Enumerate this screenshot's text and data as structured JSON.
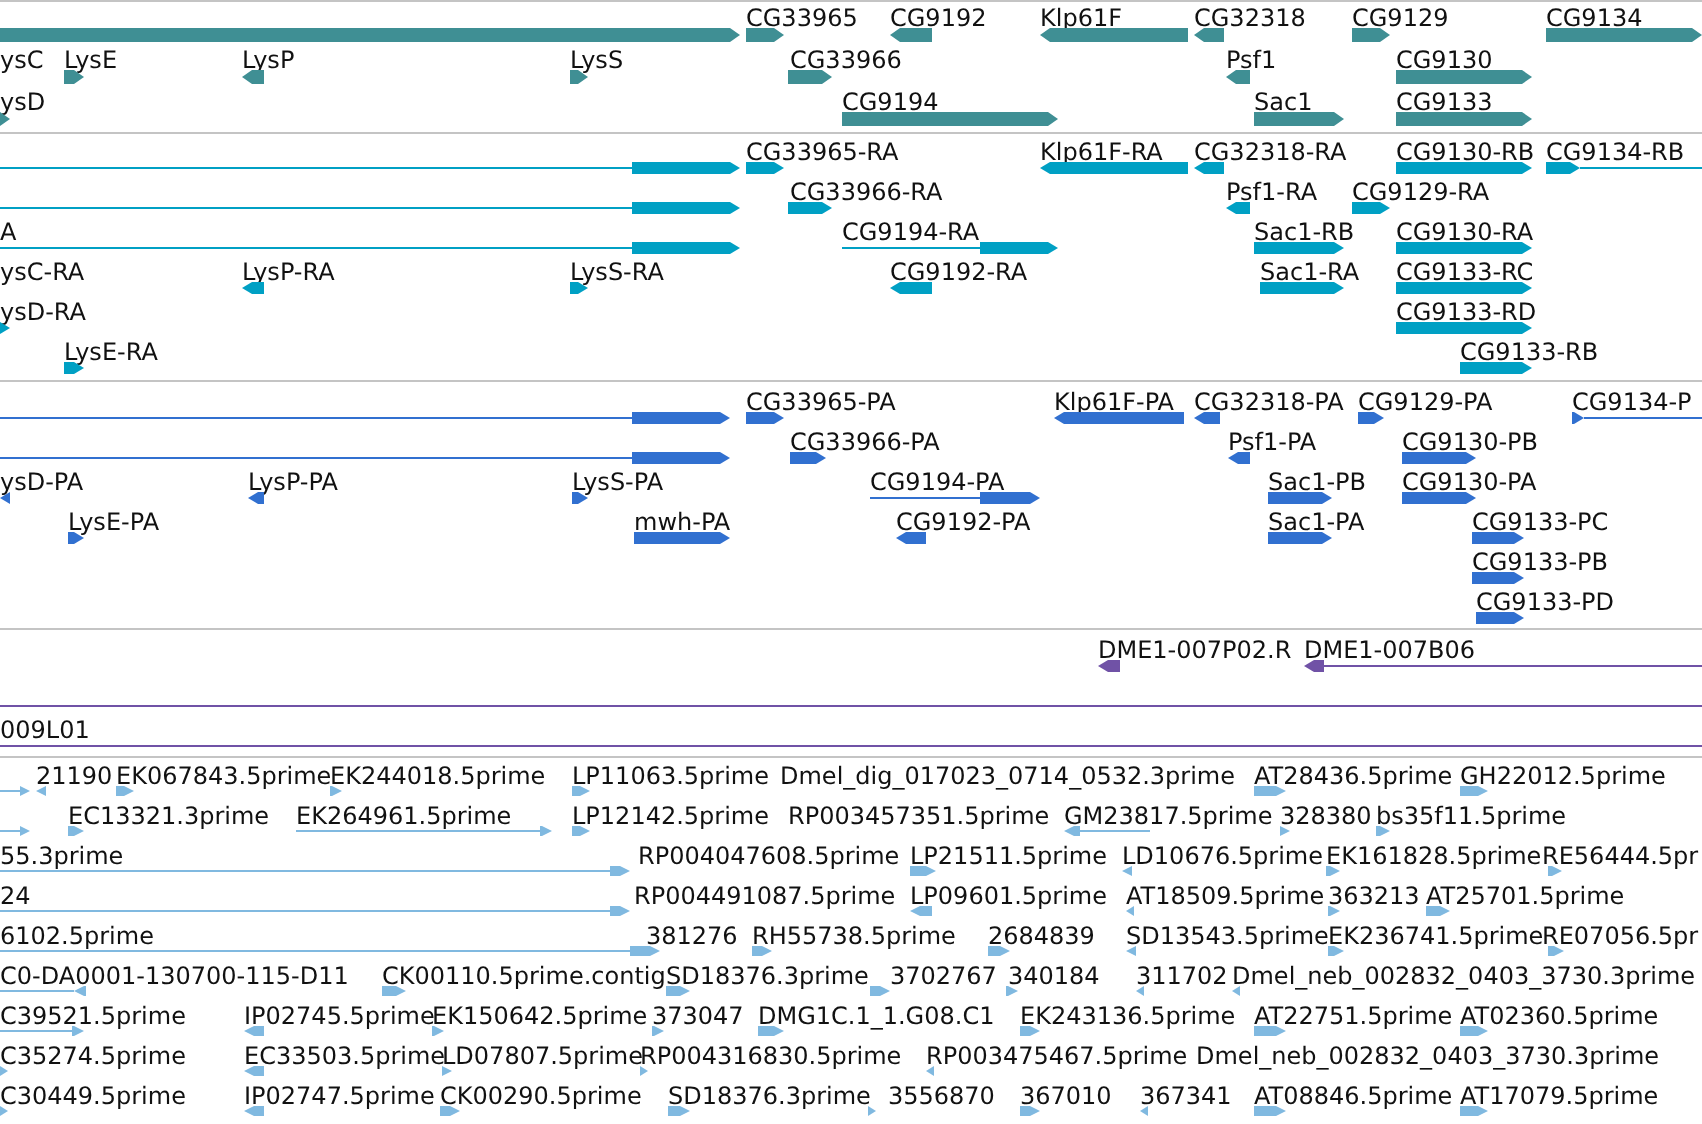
{
  "tracks": [
    {
      "kind": "gene",
      "rows": [
        {
          "features": [
            {
              "kind": "arrow",
              "reverse": false
            },
            {
              "label": "CG33965",
              "kind": "arrow",
              "reverse": false
            },
            {
              "label": "CG9192",
              "kind": "arrow",
              "reverse": true
            },
            {
              "label": "Klp61F",
              "kind": "arrow",
              "reverse": true
            },
            {
              "label": "CG32318",
              "kind": "arrow",
              "reverse": true
            },
            {
              "label": "CG9129",
              "kind": "arrow",
              "reverse": false
            },
            {
              "label": "CG9134",
              "kind": "arrow",
              "reverse": false
            }
          ]
        },
        {
          "features": [
            {
              "label": "ysC",
              "kind": "label"
            },
            {
              "label": "LysE",
              "kind": "arrow",
              "reverse": false
            },
            {
              "label": "LysP",
              "kind": "arrow",
              "reverse": true
            },
            {
              "label": "LysS",
              "kind": "arrow",
              "reverse": false
            },
            {
              "label": "CG33966",
              "kind": "arrow",
              "reverse": false
            },
            {
              "label": "Psf1",
              "kind": "arrow",
              "reverse": true
            },
            {
              "label": "CG9130",
              "kind": "arrow",
              "reverse": false
            }
          ]
        },
        {
          "features": [
            {
              "label": "ysD",
              "kind": "arrow",
              "reverse": false
            },
            {
              "label": "CG9194",
              "kind": "arrow",
              "reverse": false
            },
            {
              "label": "Sac1",
              "kind": "arrow",
              "reverse": false
            },
            {
              "label": "CG9133",
              "kind": "arrow",
              "reverse": false
            }
          ]
        }
      ]
    },
    {
      "kind": "mrna",
      "rows": [
        {
          "features": [
            {
              "kind": "arrow",
              "reverse": false
            },
            {
              "label": "CG33965-RA",
              "kind": "arrow",
              "reverse": false
            },
            {
              "label": "Klp61F-RA",
              "kind": "arrow",
              "reverse": true
            },
            {
              "label": "CG32318-RA",
              "kind": "arrow",
              "reverse": true
            },
            {
              "label": "CG9130-RB",
              "kind": "arrow",
              "reverse": false
            },
            {
              "label": "CG9134-RB",
              "kind": "arrow",
              "reverse": false
            }
          ]
        },
        {
          "features": [
            {
              "kind": "arrow",
              "reverse": false
            },
            {
              "label": "CG33966-RA",
              "kind": "arrow",
              "reverse": false
            },
            {
              "label": "Psf1-RA",
              "kind": "arrow",
              "reverse": true
            },
            {
              "label": "CG9129-RA",
              "kind": "arrow",
              "reverse": false
            }
          ]
        },
        {
          "features": [
            {
              "label": "A",
              "kind": "arrow",
              "reverse": false
            },
            {
              "label": "CG9194-RA",
              "kind": "arrow",
              "reverse": false
            },
            {
              "label": "Sac1-RB",
              "kind": "arrow",
              "reverse": false
            },
            {
              "label": "CG9130-RA",
              "kind": "arrow",
              "reverse": false
            }
          ]
        },
        {
          "features": [
            {
              "label": "ysC-RA",
              "kind": "label"
            },
            {
              "label": "LysP-RA",
              "kind": "arrow",
              "reverse": true
            },
            {
              "label": "LysS-RA",
              "kind": "arrow",
              "reverse": false
            },
            {
              "label": "CG9192-RA",
              "kind": "arrow",
              "reverse": true
            },
            {
              "label": "Sac1-RA",
              "kind": "arrow",
              "reverse": false
            },
            {
              "label": "CG9133-RC",
              "kind": "arrow",
              "reverse": false
            }
          ]
        },
        {
          "features": [
            {
              "label": "ysD-RA",
              "kind": "arrow",
              "reverse": false
            },
            {
              "label": "CG9133-RD",
              "kind": "arrow",
              "reverse": false
            }
          ]
        },
        {
          "features": [
            {
              "label": "LysE-RA",
              "kind": "arrow",
              "reverse": false
            },
            {
              "label": "CG9133-RB",
              "kind": "arrow",
              "reverse": false
            }
          ]
        }
      ]
    },
    {
      "kind": "protein",
      "rows": [
        {
          "features": [
            {
              "kind": "arrow",
              "reverse": false
            },
            {
              "label": "CG33965-PA",
              "kind": "arrow",
              "reverse": false
            },
            {
              "label": "Klp61F-PA",
              "kind": "arrow",
              "reverse": true
            },
            {
              "label": "CG32318-PA",
              "kind": "arrow",
              "reverse": true
            },
            {
              "label": "CG9129-PA",
              "kind": "arrow",
              "reverse": false
            },
            {
              "label": "CG9134-P",
              "kind": "arrow",
              "reverse": false
            }
          ]
        },
        {
          "features": [
            {
              "kind": "arrow",
              "reverse": false
            },
            {
              "label": "CG33966-PA",
              "kind": "arrow",
              "reverse": false
            },
            {
              "label": "Psf1-PA",
              "kind": "arrow",
              "reverse": true
            },
            {
              "label": "CG9130-PB",
              "kind": "arrow",
              "reverse": false
            }
          ]
        },
        {
          "features": [
            {
              "label": "ysD-PA",
              "kind": "arrow",
              "reverse": true
            },
            {
              "label": "LysP-PA",
              "kind": "arrow",
              "reverse": true
            },
            {
              "label": "LysS-PA",
              "kind": "arrow",
              "reverse": false
            },
            {
              "label": "CG9194-PA",
              "kind": "arrow",
              "reverse": false
            },
            {
              "label": "Sac1-PB",
              "kind": "arrow",
              "reverse": false
            },
            {
              "label": "CG9130-PA",
              "kind": "arrow",
              "reverse": false
            }
          ]
        },
        {
          "features": [
            {
              "label": "LysE-PA",
              "kind": "arrow",
              "reverse": false
            },
            {
              "label": "mwh-PA",
              "kind": "arrow",
              "reverse": false
            },
            {
              "label": "CG9192-PA",
              "kind": "arrow",
              "reverse": true
            },
            {
              "label": "Sac1-PA",
              "kind": "arrow",
              "reverse": false
            },
            {
              "label": "CG9133-PC",
              "kind": "arrow",
              "reverse": false
            }
          ]
        },
        {
          "features": [
            {
              "label": "CG9133-PB",
              "kind": "arrow",
              "reverse": false
            }
          ]
        },
        {
          "features": [
            {
              "label": "CG9133-PD",
              "kind": "arrow",
              "reverse": false
            }
          ]
        }
      ]
    },
    {
      "kind": "clone",
      "rows": [
        {
          "features": [
            {
              "label": "DME1-007P02.R",
              "kind": "arrow",
              "reverse": true
            },
            {
              "label": "DME1-007B06",
              "kind": "arrow",
              "reverse": true
            }
          ]
        },
        {
          "features": [
            {
              "kind": "line"
            }
          ]
        },
        {
          "features": [
            {
              "label": "009L01",
              "kind": "line"
            }
          ]
        }
      ]
    },
    {
      "kind": "est",
      "rows": [
        {
          "features": [
            {
              "kind": "arrow",
              "reverse": false
            },
            {
              "label": "21190",
              "kind": "arrow",
              "reverse": true
            },
            {
              "label": "EK067843.5prime",
              "kind": "arrow",
              "reverse": false
            },
            {
              "label": "EK244018.5prime",
              "kind": "arrow",
              "reverse": false
            },
            {
              "label": "LP11063.5prime",
              "kind": "arrow",
              "reverse": false
            },
            {
              "label": "Dmel_dig_017023_0714_0532.3prime",
              "kind": "label"
            },
            {
              "label": "AT28436.5prime",
              "kind": "arrow",
              "reverse": false
            },
            {
              "label": "GH22012.5prime",
              "kind": "arrow",
              "reverse": false
            }
          ]
        },
        {
          "features": [
            {
              "kind": "arrow",
              "reverse": false
            },
            {
              "label": "EC13321.3prime",
              "kind": "arrow",
              "reverse": false
            },
            {
              "label": "EK264961.5prime",
              "kind": "arrow",
              "reverse": false
            },
            {
              "label": "LP12142.5prime",
              "kind": "arrow",
              "reverse": false
            },
            {
              "label": "RP003457351.5prime",
              "kind": "label"
            },
            {
              "label": "GM23817.5prime",
              "kind": "arrow",
              "reverse": true
            },
            {
              "label": "328380",
              "kind": "arrow",
              "reverse": false
            },
            {
              "label": "bs35f11.5prime",
              "kind": "arrow",
              "reverse": false
            }
          ]
        },
        {
          "features": [
            {
              "label": "55.3prime",
              "kind": "arrow",
              "reverse": false
            },
            {
              "label": "RP004047608.5prime",
              "kind": "label"
            },
            {
              "label": "LP21511.5prime",
              "kind": "arrow",
              "reverse": false
            },
            {
              "label": "LD10676.5prime",
              "kind": "arrow",
              "reverse": true
            },
            {
              "label": "EK161828.5prime",
              "kind": "arrow",
              "reverse": false
            },
            {
              "label": "RE56444.5pr",
              "kind": "arrow",
              "reverse": false
            }
          ]
        },
        {
          "features": [
            {
              "label": "24",
              "kind": "arrow",
              "reverse": false
            },
            {
              "label": "RP004491087.5prime",
              "kind": "label"
            },
            {
              "label": "LP09601.5prime",
              "kind": "arrow",
              "reverse": true
            },
            {
              "label": "AT18509.5prime",
              "kind": "arrow",
              "reverse": true
            },
            {
              "label": "363213",
              "kind": "arrow",
              "reverse": false
            },
            {
              "label": "AT25701.5prime",
              "kind": "arrow",
              "reverse": false
            }
          ]
        },
        {
          "features": [
            {
              "label": "6102.5prime",
              "kind": "arrow",
              "reverse": false
            },
            {
              "label": "381276",
              "kind": "label"
            },
            {
              "label": "RH55738.5prime",
              "kind": "arrow",
              "reverse": false
            },
            {
              "label": "2684839",
              "kind": "arrow",
              "reverse": false
            },
            {
              "label": "SD13543.5prime",
              "kind": "arrow",
              "reverse": true
            },
            {
              "label": "EK236741.5prime",
              "kind": "arrow",
              "reverse": false
            },
            {
              "label": "RE07056.5pr",
              "kind": "arrow",
              "reverse": false
            }
          ]
        },
        {
          "features": [
            {
              "label": "C0-DA0001-130700-115-D11",
              "kind": "arrow",
              "reverse": true
            },
            {
              "label": "CK00110.5prime.contig",
              "kind": "arrow",
              "reverse": false
            },
            {
              "label": "SD18376.3prime",
              "kind": "arrow",
              "reverse": false
            },
            {
              "label": "3702767",
              "kind": "arrow",
              "reverse": false
            },
            {
              "label": "340184",
              "kind": "arrow",
              "reverse": false
            },
            {
              "label": "311702",
              "kind": "arrow",
              "reverse": true
            },
            {
              "label": "Dmel_neb_002832_0403_3730.3prime",
              "kind": "arrow",
              "reverse": true
            }
          ]
        },
        {
          "features": [
            {
              "label": "C39521.5prime",
              "kind": "arrow",
              "reverse": false
            },
            {
              "label": "IP02745.5prime",
              "kind": "arrow",
              "reverse": true
            },
            {
              "label": "EK150642.5prime",
              "kind": "arrow",
              "reverse": false
            },
            {
              "label": "373047",
              "kind": "arrow",
              "reverse": false
            },
            {
              "label": "DMG1C.1_1.G08.C1",
              "kind": "arrow",
              "reverse": false
            },
            {
              "label": "EK243136.5prime",
              "kind": "arrow",
              "reverse": false
            },
            {
              "label": "AT22751.5prime",
              "kind": "arrow",
              "reverse": false
            },
            {
              "label": "AT02360.5prime",
              "kind": "arrow",
              "reverse": false
            }
          ]
        },
        {
          "features": [
            {
              "label": "C35274.5prime",
              "kind": "arrow",
              "reverse": false
            },
            {
              "label": "EC33503.5prime",
              "kind": "arrow",
              "reverse": true
            },
            {
              "label": "LD07807.5prime",
              "kind": "arrow",
              "reverse": false
            },
            {
              "label": "RP004316830.5prime",
              "kind": "arrow",
              "reverse": false
            },
            {
              "label": "RP003475467.5prime",
              "kind": "arrow",
              "reverse": true
            },
            {
              "label": "Dmel_neb_002832_0403_3730.3prime",
              "kind": "label"
            }
          ]
        },
        {
          "features": [
            {
              "label": "C30449.5prime",
              "kind": "arrow",
              "reverse": false
            },
            {
              "label": "IP02747.5prime",
              "kind": "arrow",
              "reverse": true
            },
            {
              "label": "CK00290.5prime",
              "kind": "arrow",
              "reverse": false
            },
            {
              "label": "SD18376.3prime",
              "kind": "arrow",
              "reverse": false
            },
            {
              "label": "3556870",
              "kind": "arrow",
              "reverse": false
            },
            {
              "label": "367010",
              "kind": "arrow",
              "reverse": false
            },
            {
              "label": "367341",
              "kind": "arrow",
              "reverse": true
            },
            {
              "label": "AT08846.5prime",
              "kind": "arrow",
              "reverse": false
            },
            {
              "label": "AT17079.5prime",
              "kind": "arrow",
              "reverse": false
            }
          ]
        }
      ]
    }
  ]
}
